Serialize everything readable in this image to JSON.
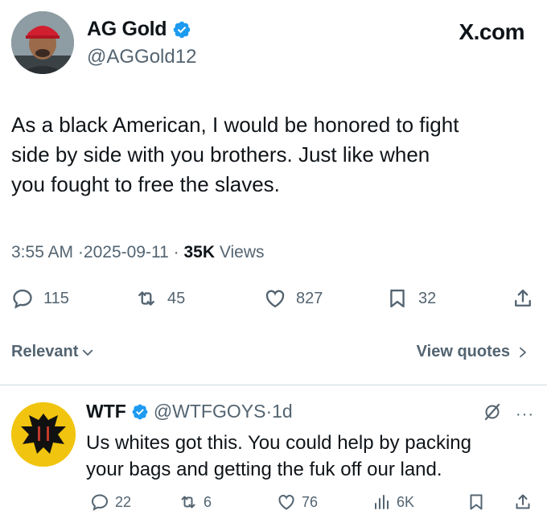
{
  "brand": "X.com",
  "tweet": {
    "author_name": "AG Gold",
    "author_handle": "@AGGold12",
    "text_lines": [
      "As a black American, I would be honored to fight",
      "side by side with you brothers. Just like when",
      "you fought to free the slaves."
    ],
    "time": "3:55 AM",
    "date": "2025-09-11",
    "views_count": "35K",
    "views_label": "Views",
    "separator": "·",
    "replies": "115",
    "reposts": "45",
    "likes": "827",
    "bookmarks": "32"
  },
  "sort": {
    "relevant_label": "Relevant",
    "view_quotes_label": "View quotes"
  },
  "reply": {
    "author_name": "WTF",
    "author_handle": "@WTFGOYS",
    "separator": "·",
    "age": "1d",
    "text_lines": [
      "Us whites got this. You could help by packing",
      "your bags and getting the fuk off our land."
    ],
    "replies": "22",
    "reposts": "6",
    "likes": "76",
    "views": "6K"
  },
  "colors": {
    "text": "#0f1419",
    "secondary": "#536471",
    "verified": "#1d9bf0",
    "divider": "#cfd9de"
  },
  "icons": [
    "verified-badge-icon",
    "reply-icon",
    "repost-icon",
    "like-icon",
    "bookmark-icon",
    "share-icon",
    "chevron-down-icon",
    "chevron-right-icon",
    "grok-icon",
    "more-icon",
    "views-icon"
  ]
}
